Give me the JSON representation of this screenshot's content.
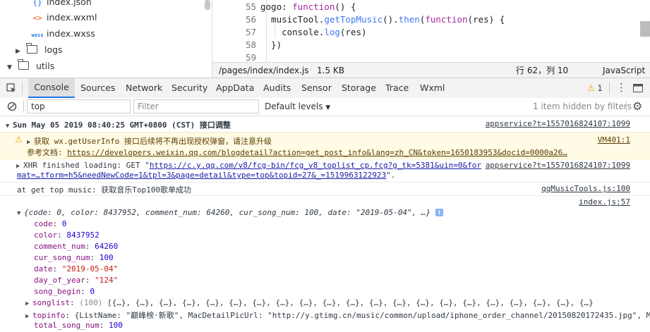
{
  "file_tree": {
    "items": [
      {
        "icon": "{}",
        "icon_name": "json-file-icon",
        "label": "index.json"
      },
      {
        "icon": "<>",
        "icon_name": "wxml-file-icon",
        "label": "index.wxml"
      },
      {
        "icon": "wxss",
        "icon_name": "wxss-file-icon",
        "label": "index.wxss"
      },
      {
        "label": "logs",
        "expanded": false
      },
      {
        "label": "utils",
        "expanded": true
      }
    ]
  },
  "editor": {
    "lines": [
      {
        "num": "55",
        "text": "gogo: function() {"
      },
      {
        "num": "56",
        "text": "  musicTool.getTopMusic().then(function(res) {"
      },
      {
        "num": "57",
        "text": "    console.log(res)"
      },
      {
        "num": "58",
        "text": "  })"
      },
      {
        "num": "59",
        "text": ""
      }
    ]
  },
  "status_bar": {
    "path": "/pages/index/index.js",
    "size": "1.5 KB",
    "position": "行 62，列 10",
    "language": "JavaScript"
  },
  "devtools_tabs": [
    "Console",
    "Sources",
    "Network",
    "Security",
    "AppData",
    "Audits",
    "Sensor",
    "Storage",
    "Trace",
    "Wxml"
  ],
  "active_tab": "Console",
  "warning_count": "1",
  "console_toolbar": {
    "context": "top",
    "filter_placeholder": "Filter",
    "levels": "Default levels",
    "hidden_note": "1 item hidden by filters"
  },
  "messages": {
    "group_header": {
      "text": "Sun May 05 2019 08:40:25 GMT+0800 (CST) 接口调整",
      "source": "appservice?t=1557016824107:1099"
    },
    "warning": {
      "line1": "获取 wx.getUserInfo 接口后续将不再出现授权弹窗，请注意升级",
      "line2_label": "参考文档: ",
      "line2_link": "https://developers.weixin.qq.com/blogdetail?action=get_post_info&lang=zh_CN&token=1650183953&docid=0000a26…",
      "source": "VM401:1"
    },
    "xhr": {
      "prefix": "XHR finished loading: GET \"",
      "url1": "https://c.y.qq.com/v8/fcg-bin/fcg_v8_toplist_cp.fcg?g_tk=5381&uin=0&for",
      "url2": "mat=…tform=h5&needNewCode=1&tpl=3&page=detail&type=top&topid=27&_=1519963122923",
      "suffix": "\".",
      "source": "appservice?t=1557016824107:1099"
    },
    "log": {
      "text": "at get top music: 获取音乐Top100歌单成功",
      "source": "qqMusicTools.js:100"
    },
    "object": {
      "source": "index.js:57",
      "summary": "{code: 0, color: 8437952, comment_num: 64260, cur_song_num: 100, date: \"2019-05-04\", …}",
      "props": [
        {
          "key": "code",
          "value": "0",
          "type": "num"
        },
        {
          "key": "color",
          "value": "8437952",
          "type": "num"
        },
        {
          "key": "comment_num",
          "value": "64260",
          "type": "num"
        },
        {
          "key": "cur_song_num",
          "value": "100",
          "type": "num"
        },
        {
          "key": "date",
          "value": "\"2019-05-04\"",
          "type": "str"
        },
        {
          "key": "day_of_year",
          "value": "\"124\"",
          "type": "str"
        },
        {
          "key": "song_begin",
          "value": "0",
          "type": "num"
        }
      ],
      "songlist": {
        "key": "songlist",
        "count": "(100)",
        "preview": "[{…}, {…}, {…}, {…}, {…}, {…}, {…}, {…}, {…}, {…}, {…}, {…}, {…}, {…}, {…}, {…}, {…}, {…}, {…}, {…}, {…}"
      },
      "topinfo": {
        "key": "topinfo",
        "preview": "{ListName: \"巅峰榜·新歌\", MacDetailPicUrl: \"http://y.gtimg.cn/music/common/upload/iphone_order_channel/20150820172435.jpg\", M"
      },
      "total": {
        "key": "total_song_num",
        "value": "100"
      }
    }
  },
  "colors": {
    "accent": "#1a73e8",
    "warning_bg": "#fffbe5",
    "warning_border": "#fff5c2",
    "link": "#1a1aa6"
  }
}
